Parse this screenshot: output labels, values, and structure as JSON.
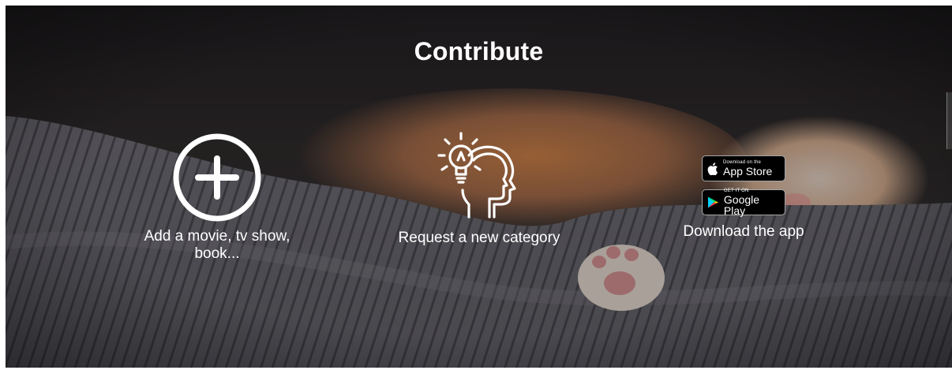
{
  "section": {
    "title": "Contribute"
  },
  "actions": {
    "add": {
      "label": "Add a movie, tv show, book...",
      "icon": "plus-circle-icon"
    },
    "request": {
      "label": "Request a new category",
      "icon": "lightbulb-head-icon"
    },
    "download": {
      "label": "Download the app",
      "app_store": {
        "small": "Download on the",
        "big": "App Store",
        "icon": "apple-icon"
      },
      "google_play": {
        "small": "GET IT ON",
        "big": "Google Play",
        "icon": "play-triangle-icon"
      }
    }
  },
  "colors": {
    "text": "#ffffff",
    "bg_dark": "#2a2628",
    "fur_orange": "#c77a3e",
    "badge_bg": "#000000"
  }
}
